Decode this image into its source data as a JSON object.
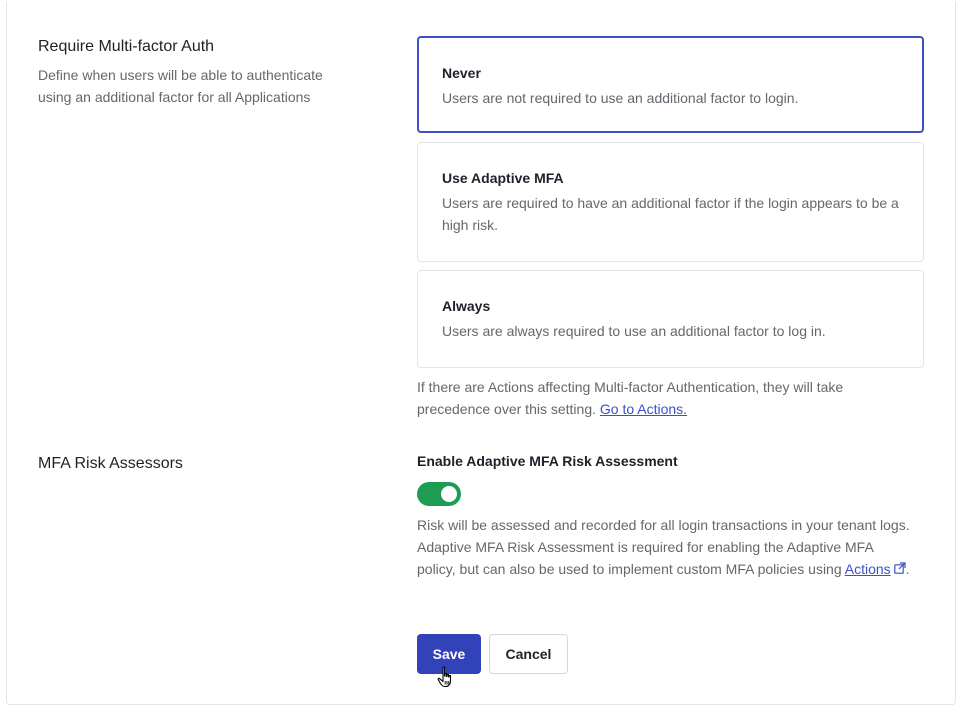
{
  "mfa_policy": {
    "title": "Require Multi-factor Auth",
    "description_line1": "Define when users will be able to authenticate",
    "description_line2": "using an additional factor for all Applications",
    "selected": "never",
    "options": [
      {
        "id": "never",
        "title": "Never",
        "description": "Users are not required to use an additional factor to login."
      },
      {
        "id": "adaptive",
        "title": "Use Adaptive MFA",
        "description": "Users are required to have an additional factor if the login appears to be a high risk."
      },
      {
        "id": "always",
        "title": "Always",
        "description": "Users are always required to use an additional factor to log in."
      }
    ],
    "note_text": "If there are Actions affecting Multi-factor Authentication, they will take precedence over this setting.",
    "note_link": "Go to Actions."
  },
  "risk_assessors": {
    "title": "MFA Risk Assessors",
    "toggle_label": "Enable Adaptive MFA Risk Assessment",
    "toggle_on": true,
    "description": "Risk will be assessed and recorded for all login transactions in your tenant logs. Adaptive MFA Risk Assessment is required for enabling the Adaptive MFA policy, but can also be used to implement custom MFA policies using",
    "actions_link": "Actions",
    "trailing_period": "."
  },
  "buttons": {
    "save": "Save",
    "cancel": "Cancel"
  },
  "colors": {
    "primary": "#3242b9",
    "selected_border": "#3d4fc7",
    "toggle_on": "#1f9c53",
    "link": "#3d4fc7"
  }
}
